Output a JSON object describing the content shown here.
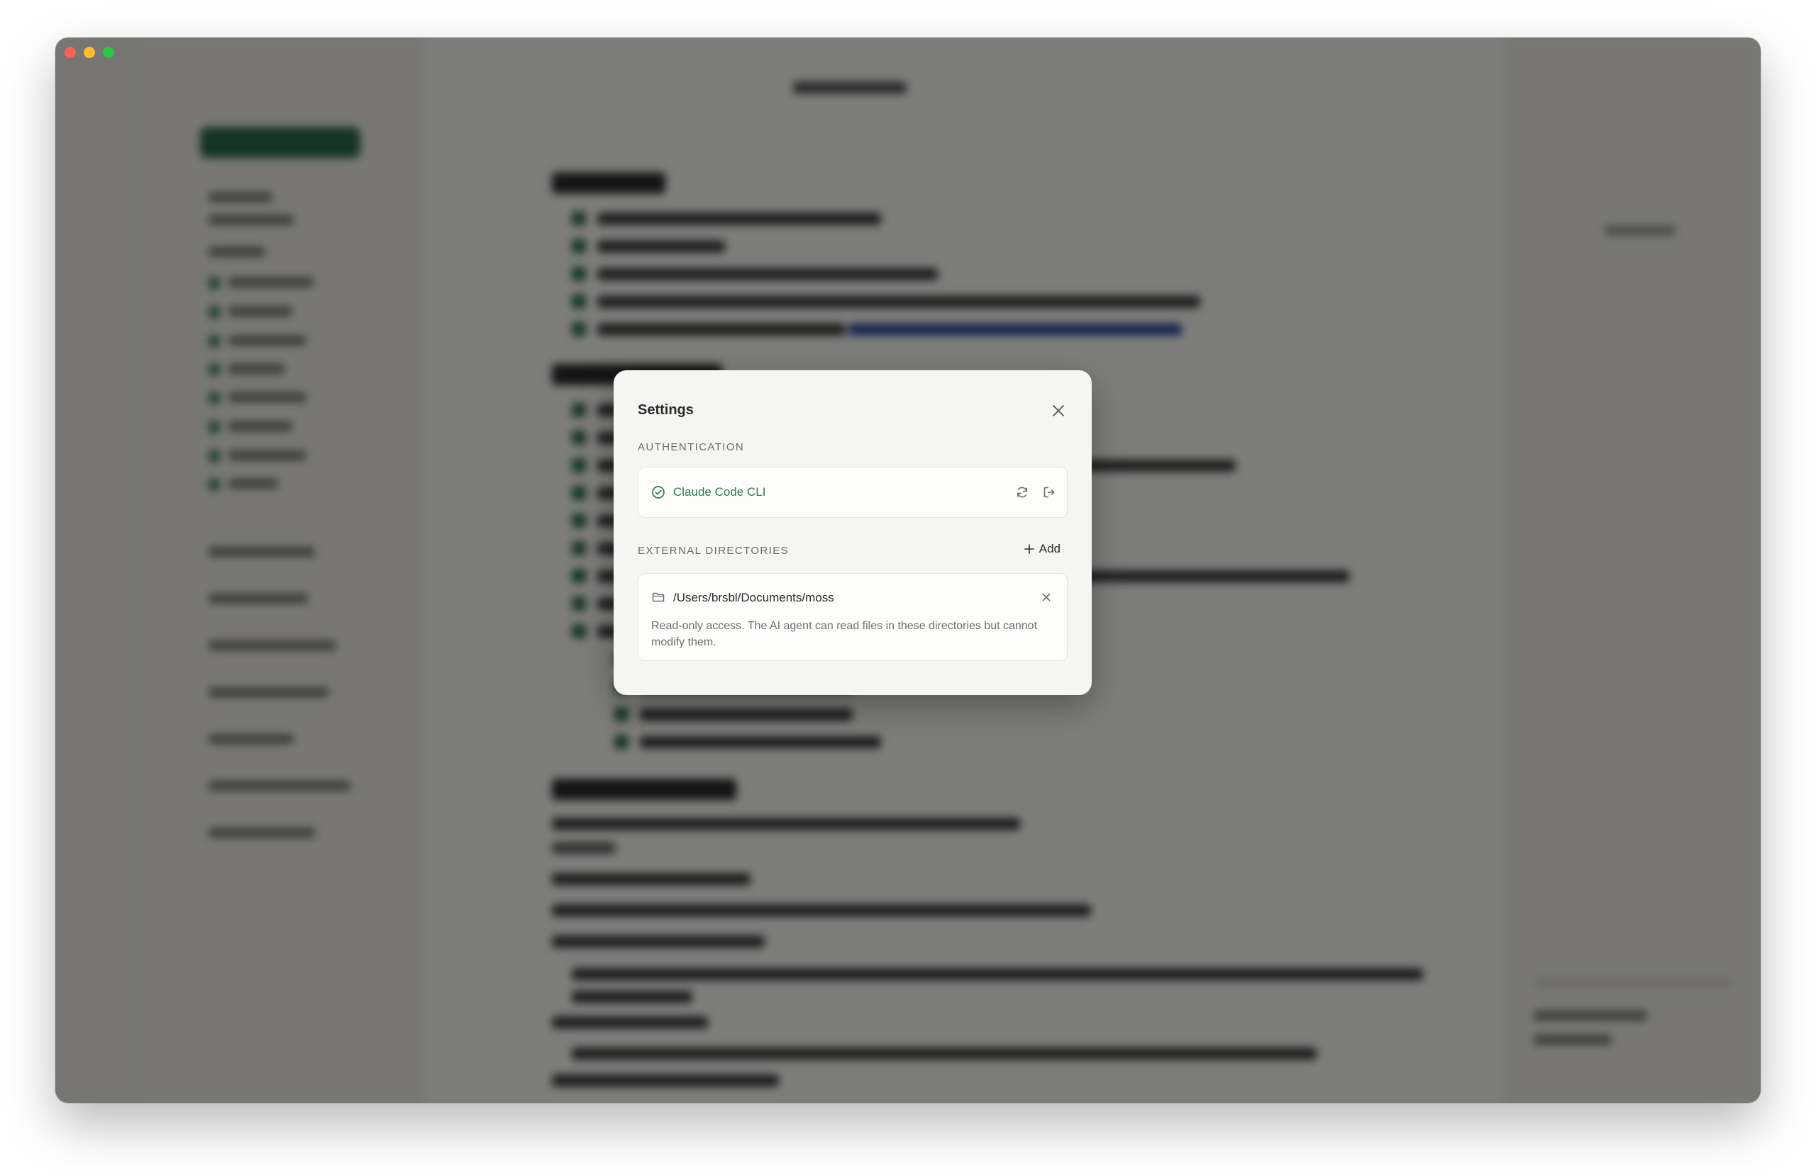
{
  "settings": {
    "title": "Settings",
    "authentication": {
      "section_label": "AUTHENTICATION",
      "provider_name": "Claude Code CLI",
      "status_icon": "check-circle-icon",
      "refresh_icon": "refresh-icon",
      "logout_icon": "logout-icon"
    },
    "external_directories": {
      "section_label": "EXTERNAL DIRECTORIES",
      "add_label": "Add",
      "items": [
        {
          "path": "/Users/brsbl/Documents/moss",
          "note": "Read-only access. The AI agent can read files in these directories but cannot modify them."
        }
      ]
    }
  },
  "colors": {
    "accent_green": "#2f7a4e",
    "modal_background": "#f5f5f3",
    "overlay": "rgba(0,0,0,0.5)"
  }
}
